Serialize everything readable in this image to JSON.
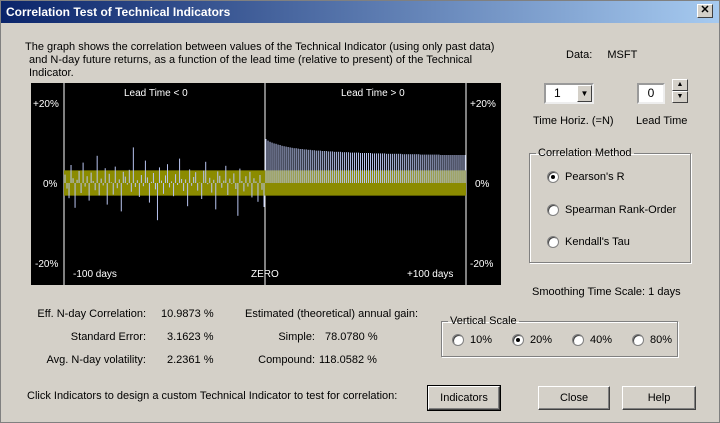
{
  "window": {
    "title": "Correlation Test of Technical Indicators",
    "close_glyph": "✕"
  },
  "description": {
    "line1": "The graph shows the correlation between values of the Technical Indicator (using only past data)",
    "line2": "and N-day future returns, as a function of the lead time (relative to present) of the Technical Indicator."
  },
  "data_info": {
    "label": "Data:",
    "value": "MSFT"
  },
  "time_horiz": {
    "value": "1",
    "label": "Time Horiz. (=N)"
  },
  "lead_time": {
    "value": "0",
    "label": "Lead Time"
  },
  "correlation_method": {
    "legend": "Correlation Method",
    "options": [
      {
        "label": "Pearson's R",
        "selected": true
      },
      {
        "label": "Spearman Rank-Order",
        "selected": false
      },
      {
        "label": "Kendall's Tau",
        "selected": false
      }
    ]
  },
  "smoothing": {
    "text": "Smoothing Time Scale:  1 days"
  },
  "vertical_scale": {
    "legend": "Vertical Scale",
    "options": [
      {
        "label": "10%",
        "selected": false
      },
      {
        "label": "20%",
        "selected": true
      },
      {
        "label": "40%",
        "selected": false
      },
      {
        "label": "80%",
        "selected": false
      }
    ]
  },
  "stats": {
    "eff_corr_label": "Eff. N-day Correlation:",
    "eff_corr_value": "10.9873 %",
    "std_err_label": "Standard Error:",
    "std_err_value": "3.1623 %",
    "avg_vol_label": "Avg. N-day volatility:",
    "avg_vol_value": "2.2361 %",
    "gain_heading": "Estimated (theoretical) annual gain:",
    "simple_label": "Simple:",
    "simple_value": "78.0780 %",
    "compound_label": "Compound:",
    "compound_value": "118.0582 %"
  },
  "footer": {
    "hint": "Click Indicators to design a custom Technical Indicator to test for correlation:",
    "indicators_label": "Indicators",
    "close_label": "Close",
    "help_label": "Help"
  },
  "colors": {
    "plot_bg": "#000000",
    "band": "#8b8b00",
    "bars": "#b8c4f0",
    "text": "#ffffff"
  },
  "chart_data": {
    "type": "bar",
    "title": "",
    "region_left_label": "Lead Time < 0",
    "region_right_label": "Lead Time > 0",
    "x_left_label": "-100 days",
    "x_center_label": "ZERO",
    "x_right_label": "+100 days",
    "y_ticks": [
      "+20%",
      "0%",
      "-20%"
    ],
    "ylim": [
      -20,
      20
    ],
    "xlim": [
      -100,
      100
    ],
    "band_halfwidth": 3.16,
    "negative_lead_values": [
      2.1,
      -1.4,
      -3.8,
      4.5,
      1.2,
      -6.2,
      0.8,
      3.0,
      -2.5,
      5.1,
      -0.9,
      1.7,
      -4.4,
      2.6,
      0.5,
      -1.8,
      6.8,
      -3.1,
      1.1,
      -0.6,
      3.7,
      -5.4,
      2.3,
      0.2,
      -2.9,
      4.1,
      -1.3,
      0.9,
      -7.1,
      2.8,
      1.6,
      -0.4,
      3.3,
      -2.2,
      8.9,
      -1.0,
      0.7,
      -3.5,
      2.0,
      -0.8,
      5.6,
      1.4,
      -4.9,
      0.3,
      2.5,
      -1.6,
      -9.3,
      3.9,
      0.6,
      -2.7,
      1.9,
      4.7,
      -1.1,
      0.4,
      -3.3,
      2.2,
      -0.5,
      6.1,
      1.0,
      -2.0,
      0.9,
      -5.8,
      3.4,
      -0.7,
      1.5,
      2.7,
      -1.9,
      0.1,
      -4.0,
      3.1,
      5.3,
      -0.3,
      1.3,
      -2.4,
      0.8,
      -6.6,
      2.9,
      1.8,
      -1.2,
      0.6,
      4.3,
      -3.0,
      1.1,
      -0.2,
      2.4,
      -1.5,
      -8.2,
      3.6,
      0.5,
      -2.1,
      1.7,
      -0.9,
      2.8,
      -3.6,
      1.2,
      0.4,
      -4.7,
      2.0,
      -1.7,
      -6.0
    ],
    "positive_lead_values": [
      11.0,
      10.6,
      10.3,
      10.1,
      9.9,
      9.8,
      9.6,
      9.5,
      9.3,
      9.2,
      9.1,
      9.0,
      8.9,
      8.8,
      8.7,
      8.7,
      8.6,
      8.5,
      8.5,
      8.4,
      8.4,
      8.3,
      8.3,
      8.2,
      8.2,
      8.1,
      8.1,
      8.1,
      8.0,
      8.0,
      8.0,
      7.9,
      7.9,
      7.9,
      7.8,
      7.8,
      7.8,
      7.8,
      7.7,
      7.7,
      7.7,
      7.7,
      7.6,
      7.6,
      7.6,
      7.6,
      7.6,
      7.5,
      7.5,
      7.5,
      7.5,
      7.5,
      7.5,
      7.4,
      7.4,
      7.4,
      7.4,
      7.4,
      7.4,
      7.4,
      7.3,
      7.3,
      7.3,
      7.3,
      7.3,
      7.3,
      7.3,
      7.3,
      7.2,
      7.2,
      7.2,
      7.2,
      7.2,
      7.2,
      7.2,
      7.2,
      7.2,
      7.1,
      7.1,
      7.1,
      7.1,
      7.1,
      7.1,
      7.1,
      7.1,
      7.1,
      7.1,
      7.0,
      7.0,
      7.0,
      7.0,
      7.0,
      7.0,
      7.0,
      7.0,
      7.0,
      7.0,
      7.0,
      7.0,
      7.0
    ]
  }
}
